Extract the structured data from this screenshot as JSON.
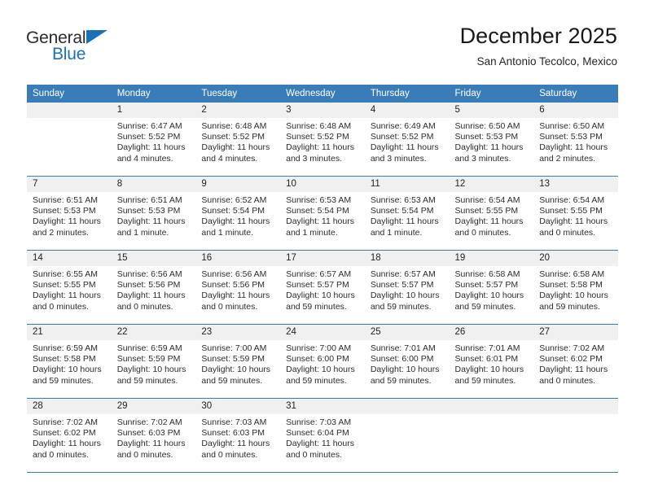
{
  "brand": {
    "name_top": "General",
    "name_bottom": "Blue",
    "accent_color": "#1b71b8"
  },
  "header": {
    "title": "December 2025",
    "subtitle": "San Antonio Tecolco, Mexico"
  },
  "theme": {
    "header_bg": "#3a7cb8",
    "header_text": "#ffffff",
    "daynum_bg": "#f0f0f0",
    "grid_line": "#3a7cb8",
    "page_bg": "#ffffff"
  },
  "calendar": {
    "weekday_headers": [
      "Sunday",
      "Monday",
      "Tuesday",
      "Wednesday",
      "Thursday",
      "Friday",
      "Saturday"
    ],
    "weeks": [
      [
        {
          "day": "",
          "sunrise": "",
          "sunset": "",
          "daylight": ""
        },
        {
          "day": "1",
          "sunrise": "Sunrise: 6:47 AM",
          "sunset": "Sunset: 5:52 PM",
          "daylight": "Daylight: 11 hours and 4 minutes."
        },
        {
          "day": "2",
          "sunrise": "Sunrise: 6:48 AM",
          "sunset": "Sunset: 5:52 PM",
          "daylight": "Daylight: 11 hours and 4 minutes."
        },
        {
          "day": "3",
          "sunrise": "Sunrise: 6:48 AM",
          "sunset": "Sunset: 5:52 PM",
          "daylight": "Daylight: 11 hours and 3 minutes."
        },
        {
          "day": "4",
          "sunrise": "Sunrise: 6:49 AM",
          "sunset": "Sunset: 5:52 PM",
          "daylight": "Daylight: 11 hours and 3 minutes."
        },
        {
          "day": "5",
          "sunrise": "Sunrise: 6:50 AM",
          "sunset": "Sunset: 5:53 PM",
          "daylight": "Daylight: 11 hours and 3 minutes."
        },
        {
          "day": "6",
          "sunrise": "Sunrise: 6:50 AM",
          "sunset": "Sunset: 5:53 PM",
          "daylight": "Daylight: 11 hours and 2 minutes."
        }
      ],
      [
        {
          "day": "7",
          "sunrise": "Sunrise: 6:51 AM",
          "sunset": "Sunset: 5:53 PM",
          "daylight": "Daylight: 11 hours and 2 minutes."
        },
        {
          "day": "8",
          "sunrise": "Sunrise: 6:51 AM",
          "sunset": "Sunset: 5:53 PM",
          "daylight": "Daylight: 11 hours and 1 minute."
        },
        {
          "day": "9",
          "sunrise": "Sunrise: 6:52 AM",
          "sunset": "Sunset: 5:54 PM",
          "daylight": "Daylight: 11 hours and 1 minute."
        },
        {
          "day": "10",
          "sunrise": "Sunrise: 6:53 AM",
          "sunset": "Sunset: 5:54 PM",
          "daylight": "Daylight: 11 hours and 1 minute."
        },
        {
          "day": "11",
          "sunrise": "Sunrise: 6:53 AM",
          "sunset": "Sunset: 5:54 PM",
          "daylight": "Daylight: 11 hours and 1 minute."
        },
        {
          "day": "12",
          "sunrise": "Sunrise: 6:54 AM",
          "sunset": "Sunset: 5:55 PM",
          "daylight": "Daylight: 11 hours and 0 minutes."
        },
        {
          "day": "13",
          "sunrise": "Sunrise: 6:54 AM",
          "sunset": "Sunset: 5:55 PM",
          "daylight": "Daylight: 11 hours and 0 minutes."
        }
      ],
      [
        {
          "day": "14",
          "sunrise": "Sunrise: 6:55 AM",
          "sunset": "Sunset: 5:55 PM",
          "daylight": "Daylight: 11 hours and 0 minutes."
        },
        {
          "day": "15",
          "sunrise": "Sunrise: 6:56 AM",
          "sunset": "Sunset: 5:56 PM",
          "daylight": "Daylight: 11 hours and 0 minutes."
        },
        {
          "day": "16",
          "sunrise": "Sunrise: 6:56 AM",
          "sunset": "Sunset: 5:56 PM",
          "daylight": "Daylight: 11 hours and 0 minutes."
        },
        {
          "day": "17",
          "sunrise": "Sunrise: 6:57 AM",
          "sunset": "Sunset: 5:57 PM",
          "daylight": "Daylight: 10 hours and 59 minutes."
        },
        {
          "day": "18",
          "sunrise": "Sunrise: 6:57 AM",
          "sunset": "Sunset: 5:57 PM",
          "daylight": "Daylight: 10 hours and 59 minutes."
        },
        {
          "day": "19",
          "sunrise": "Sunrise: 6:58 AM",
          "sunset": "Sunset: 5:57 PM",
          "daylight": "Daylight: 10 hours and 59 minutes."
        },
        {
          "day": "20",
          "sunrise": "Sunrise: 6:58 AM",
          "sunset": "Sunset: 5:58 PM",
          "daylight": "Daylight: 10 hours and 59 minutes."
        }
      ],
      [
        {
          "day": "21",
          "sunrise": "Sunrise: 6:59 AM",
          "sunset": "Sunset: 5:58 PM",
          "daylight": "Daylight: 10 hours and 59 minutes."
        },
        {
          "day": "22",
          "sunrise": "Sunrise: 6:59 AM",
          "sunset": "Sunset: 5:59 PM",
          "daylight": "Daylight: 10 hours and 59 minutes."
        },
        {
          "day": "23",
          "sunrise": "Sunrise: 7:00 AM",
          "sunset": "Sunset: 5:59 PM",
          "daylight": "Daylight: 10 hours and 59 minutes."
        },
        {
          "day": "24",
          "sunrise": "Sunrise: 7:00 AM",
          "sunset": "Sunset: 6:00 PM",
          "daylight": "Daylight: 10 hours and 59 minutes."
        },
        {
          "day": "25",
          "sunrise": "Sunrise: 7:01 AM",
          "sunset": "Sunset: 6:00 PM",
          "daylight": "Daylight: 10 hours and 59 minutes."
        },
        {
          "day": "26",
          "sunrise": "Sunrise: 7:01 AM",
          "sunset": "Sunset: 6:01 PM",
          "daylight": "Daylight: 10 hours and 59 minutes."
        },
        {
          "day": "27",
          "sunrise": "Sunrise: 7:02 AM",
          "sunset": "Sunset: 6:02 PM",
          "daylight": "Daylight: 11 hours and 0 minutes."
        }
      ],
      [
        {
          "day": "28",
          "sunrise": "Sunrise: 7:02 AM",
          "sunset": "Sunset: 6:02 PM",
          "daylight": "Daylight: 11 hours and 0 minutes."
        },
        {
          "day": "29",
          "sunrise": "Sunrise: 7:02 AM",
          "sunset": "Sunset: 6:03 PM",
          "daylight": "Daylight: 11 hours and 0 minutes."
        },
        {
          "day": "30",
          "sunrise": "Sunrise: 7:03 AM",
          "sunset": "Sunset: 6:03 PM",
          "daylight": "Daylight: 11 hours and 0 minutes."
        },
        {
          "day": "31",
          "sunrise": "Sunrise: 7:03 AM",
          "sunset": "Sunset: 6:04 PM",
          "daylight": "Daylight: 11 hours and 0 minutes."
        },
        {
          "day": "",
          "sunrise": "",
          "sunset": "",
          "daylight": ""
        },
        {
          "day": "",
          "sunrise": "",
          "sunset": "",
          "daylight": ""
        },
        {
          "day": "",
          "sunrise": "",
          "sunset": "",
          "daylight": ""
        }
      ]
    ]
  }
}
